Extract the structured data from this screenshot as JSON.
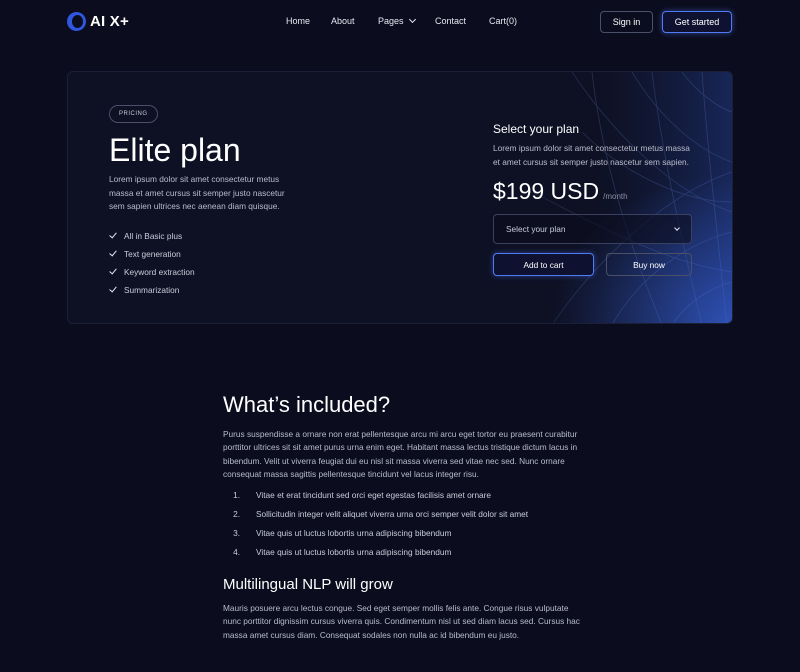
{
  "brand": {
    "name": "AI X+"
  },
  "nav": {
    "items": [
      "Home",
      "About",
      "Pages",
      "Contact",
      "Cart(0)"
    ],
    "signin": "Sign in",
    "get_started": "Get started"
  },
  "pricing": {
    "badge": "PRICING",
    "title": "Elite plan",
    "description": "Lorem ipsum dolor sit amet consectetur metus massa et amet cursus sit semper justo nascetur sem sapien ultrices nec aenean diam quisque.",
    "features": [
      "All in Basic plus",
      "Text generation",
      "Keyword extraction",
      "Summarization"
    ],
    "select_title": "Select your plan",
    "select_desc": "Lorem ipsum dolor sit amet consectetur metus massa et amet cursus sit semper justo nascetur sem sapien.",
    "price": "$199 USD",
    "per": "/month",
    "dropdown_value": "Select your plan",
    "add_to_cart": "Add to cart",
    "buy_now": "Buy now"
  },
  "included": {
    "title": "What’s included?",
    "intro": "Purus suspendisse a ornare non erat pellentesque arcu mi arcu eget tortor eu praesent curabitur porttitor ultrices sit sit amet purus urna enim eget. Habitant massa lectus tristique dictum lacus in bibendum. Velit ut viverra feugiat dui eu nisl sit massa viverra sed vitae nec sed. Nunc ornare consequat massa sagittis pellentesque tincidunt vel lacus integer risu.",
    "list": [
      {
        "num": "1.",
        "text": "Vitae et erat tincidunt sed orci eget egestas facilisis amet ornare"
      },
      {
        "num": "2.",
        "text": "Sollicitudin integer  velit aliquet viverra urna orci semper velit dolor sit amet"
      },
      {
        "num": "3.",
        "text": "Vitae quis ut  luctus lobortis urna adipiscing bibendum"
      },
      {
        "num": "4.",
        "text": "Vitae quis ut  luctus lobortis urna adipiscing bibendum"
      }
    ],
    "subtitle": "Multilingual NLP will grow",
    "outro": "Mauris posuere arcu lectus congue. Sed eget semper mollis felis ante. Congue risus vulputate nunc porttitor dignissim cursus viverra quis. Condimentum nisl ut sed diam lacus sed. Cursus hac massa amet cursus diam. Consequat sodales non nulla ac id bibendum eu justo."
  },
  "colors": {
    "background": "#0b0d1e",
    "accent": "#4f7cf5"
  }
}
